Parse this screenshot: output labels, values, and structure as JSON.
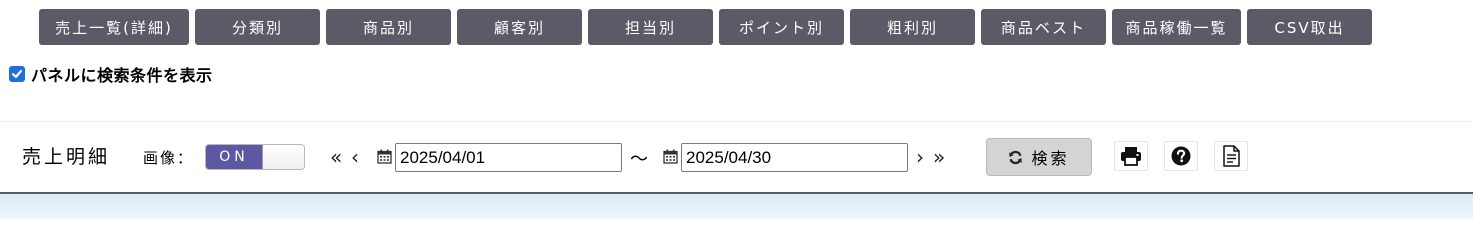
{
  "tabs": [
    {
      "label": "売上一覧(詳細)"
    },
    {
      "label": "分類別"
    },
    {
      "label": "商品別"
    },
    {
      "label": "顧客別"
    },
    {
      "label": "担当別"
    },
    {
      "label": "ポイント別"
    },
    {
      "label": "粗利別"
    },
    {
      "label": "商品ベスト"
    },
    {
      "label": "商品稼働一覧"
    },
    {
      "label": "CSV取出"
    }
  ],
  "panel": {
    "checkbox_label": "パネルに検索条件を表示",
    "checked": true
  },
  "toolbar": {
    "title": "売上明細",
    "image_label": "画像：",
    "image_toggle": "ON",
    "nav_first": "«",
    "nav_prev": "‹",
    "nav_next": "›",
    "nav_last": "»",
    "date_from": "2025/04/01",
    "date_separator": "～",
    "date_to": "2025/04/30",
    "search_label": "検索"
  },
  "icons": {
    "refresh": "refresh-icon",
    "calendar": "calendar-icon",
    "print": "print-icon",
    "help": "help-icon",
    "document": "document-icon"
  },
  "colors": {
    "tab_bg": "#5a5b66",
    "toggle_on": "#5e57a2",
    "checkbox": "#1e6fd9",
    "search_btn": "#d4d4d4",
    "band": "#e6f0fa"
  }
}
